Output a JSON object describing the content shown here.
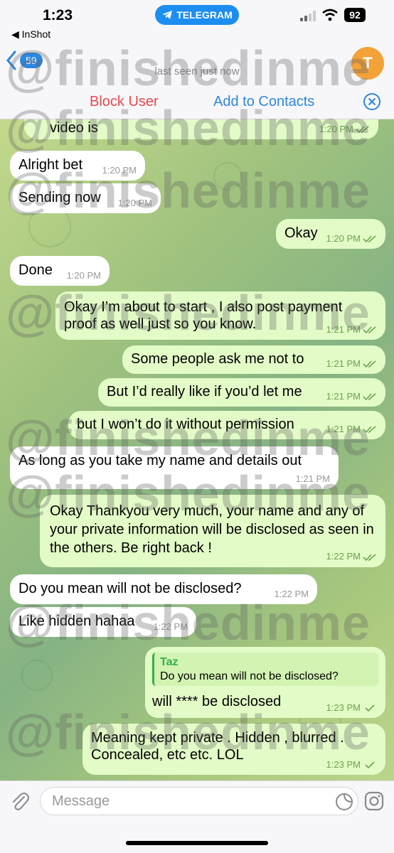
{
  "status_bar": {
    "time": "1:23",
    "back_app": "◀ InShot",
    "pill_label": "TELEGRAM",
    "battery": "92"
  },
  "header": {
    "unread_count": "59",
    "last_seen": "last seen just now",
    "avatar_letter": "T"
  },
  "actions": {
    "block_user": "Block User",
    "add_to_contacts": "Add to Contacts"
  },
  "messages": [
    {
      "dir": "out",
      "text": "video is",
      "time": "1:20 PM"
    },
    {
      "dir": "in",
      "text": "Alright bet",
      "time": "1:20 PM"
    },
    {
      "dir": "in",
      "text": "Sending now",
      "time": "1:20 PM"
    },
    {
      "dir": "out",
      "text": "Okay",
      "time": "1:20 PM"
    },
    {
      "dir": "in",
      "text": "Done",
      "time": "1:20 PM"
    },
    {
      "dir": "out",
      "text": "Okay I’m about to start , I also post payment proof as well just so you know.",
      "time": "1:21 PM"
    },
    {
      "dir": "out",
      "text": "Some people ask me not to",
      "time": "1:21 PM"
    },
    {
      "dir": "out",
      "text": "But I’d really like if you’d let me",
      "time": "1:21 PM"
    },
    {
      "dir": "out",
      "text": "but I won’t do it without permission",
      "time": "1:21 PM"
    },
    {
      "dir": "in",
      "text": "As long as you take my name and details out",
      "time": "1:21 PM"
    },
    {
      "dir": "out",
      "text": "Okay Thankyou very much, your name and any of your private information will be disclosed as seen in the others. Be right back !",
      "time": "1:22 PM"
    },
    {
      "dir": "in",
      "text": "Do you mean will not be disclosed?",
      "time": "1:22 PM"
    },
    {
      "dir": "in",
      "text": "Like hidden hahaa",
      "time": "1:22 PM"
    },
    {
      "dir": "out",
      "text": "will **** be disclosed",
      "time": "1:23 PM",
      "reply_name": "Taz",
      "reply_text": "Do you mean will not be disclosed?"
    },
    {
      "dir": "out",
      "text": "Meaning kept private . Hidden , blurred . Concealed, etc etc. LOL",
      "time": "1:23 PM"
    }
  ],
  "watermark": "@finishedinme",
  "input": {
    "placeholder": "Message"
  },
  "icons": [
    "telegram-icon",
    "wifi-icon",
    "chevron-left-icon",
    "close-circle-icon",
    "double-check-icon",
    "single-check-icon",
    "paperclip-icon",
    "sticker-icon",
    "instagram-icon"
  ],
  "colors": {
    "accent": "#2e86de",
    "danger": "#e5484d",
    "outgoing_bubble": "#e2fbc7",
    "incoming_bubble": "#ffffff",
    "avatar": "#f3a23a",
    "check": "#6aa54d"
  }
}
